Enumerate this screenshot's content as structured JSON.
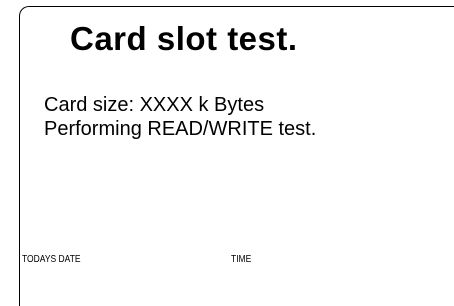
{
  "screen": {
    "title": "Card slot test.",
    "info_lines": [
      "Card size: XXXX k Bytes",
      "Performing READ/WRITE test."
    ],
    "footer": {
      "date_label": "TODAYS DATE",
      "time_label": "TIME"
    }
  },
  "colors": {
    "background": "#ffffff",
    "text": "#000000",
    "border": "#000000"
  }
}
